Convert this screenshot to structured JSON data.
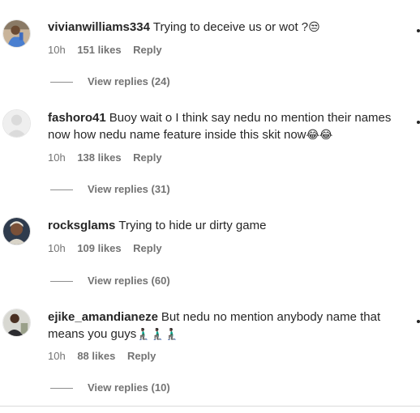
{
  "comments": [
    {
      "username": "vivianwilliams334",
      "text": "Trying to deceive us or wot ?",
      "emoji": "😒",
      "time": "10h",
      "likes": "151 likes",
      "reply": "Reply",
      "view_replies": "View replies (24)"
    },
    {
      "username": "fashoro41",
      "text": "Buoy wait o I think say nedu no mention their names now how nedu name feature inside this skit now",
      "emoji": "😂😂",
      "time": "10h",
      "likes": "138 likes",
      "reply": "Reply",
      "view_replies": "View replies (31)"
    },
    {
      "username": "rocksglams",
      "text": "Trying to hide ur dirty game",
      "emoji": "",
      "time": "10h",
      "likes": "109 likes",
      "reply": "Reply",
      "view_replies": "View replies (60)"
    },
    {
      "username": "ejike_amandianeze",
      "text": "But nedu no mention anybody name that means you guys",
      "emoji": "🧎🏿‍♂️🧎🏿‍♂️🧎🏿‍♂️",
      "time": "10h",
      "likes": "88 likes",
      "reply": "Reply",
      "view_replies": "View replies (10)"
    }
  ],
  "icons": {
    "avatar_1": "woman-in-blue-avatar-icon",
    "avatar_2": "default-avatar-icon",
    "avatar_3": "woman-portrait-avatar-icon",
    "avatar_4": "man-portrait-avatar-icon",
    "more_options": "more-options-icon"
  }
}
